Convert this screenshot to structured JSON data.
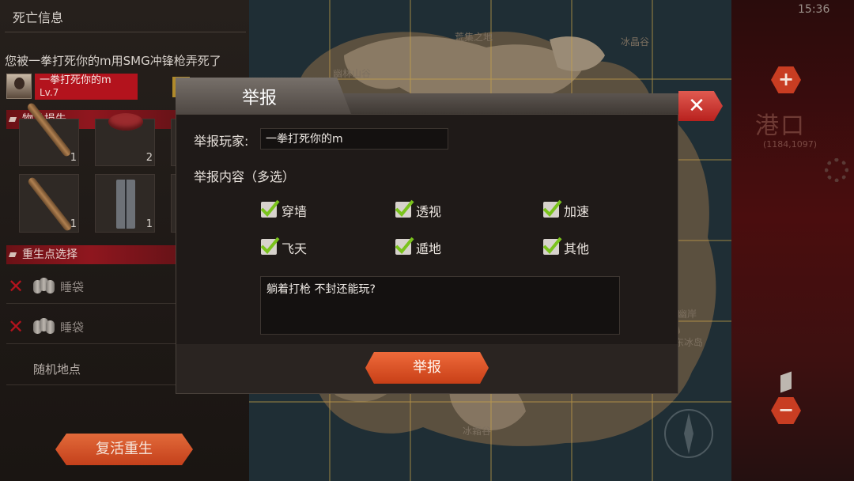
{
  "left_panel": {
    "title": "死亡信息",
    "death_message": "您被一拳打死你的m用SMG冲锋枪弄死了",
    "killer": {
      "name": "一拳打死你的m",
      "level": "Lv.7",
      "warn_symbol": "!"
    },
    "items_section": "物品损失",
    "items": [
      {
        "icon": "bat-icon",
        "count": "1"
      },
      {
        "icon": "meat-icon",
        "count": "2"
      },
      {
        "icon": "bat-icon",
        "count": "1"
      },
      {
        "icon": "pants-icon",
        "count": "1"
      }
    ],
    "spawn_section": "重生点选择",
    "spawn_points": [
      {
        "label": "睡袋"
      },
      {
        "label": "睡袋"
      }
    ],
    "random_spawn": "随机地点",
    "revive_button": "复活重生"
  },
  "map": {
    "labels": [
      "荒集之地",
      "冰晶谷",
      "幽林山谷",
      "冰幽岸",
      "东冰岛",
      "冰霜谷"
    ]
  },
  "hud": {
    "time": "15:36",
    "zoom_in": "+",
    "zoom_out": "−",
    "location": "港口",
    "coords": "(1184,1097)"
  },
  "report_dialog": {
    "title": "举报",
    "close_symbol": "✕",
    "player_label": "举报玩家:",
    "player_value": "一拳打死你的m",
    "content_label": "举报内容（多选）",
    "options": [
      {
        "label": "穿墙",
        "checked": true
      },
      {
        "label": "透视",
        "checked": true
      },
      {
        "label": "加速",
        "checked": true
      },
      {
        "label": "飞天",
        "checked": true
      },
      {
        "label": "遁地",
        "checked": true
      },
      {
        "label": "其他",
        "checked": true
      }
    ],
    "comment": "躺着打枪 不封还能玩?",
    "submit_button": "举报"
  },
  "colors": {
    "accent_red": "#b3131d",
    "button_orange": "#d9532a",
    "check_green": "#7ac31c"
  }
}
